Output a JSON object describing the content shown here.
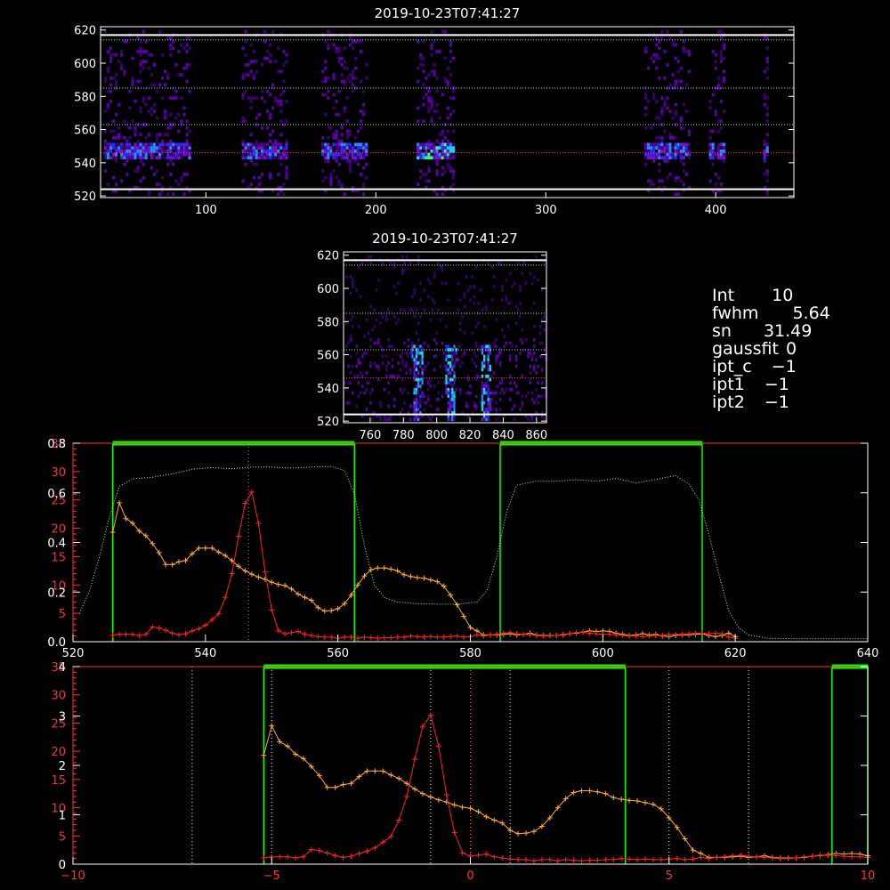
{
  "colors": {
    "background": "#000000",
    "frame": "#ffffff",
    "green": "#00ff00",
    "orange": "#ffaa33",
    "red": "#ff2020",
    "dotted_yellow": "#ffff99",
    "dotted_green": "#b8ff66",
    "axis_red": "#ff3030"
  },
  "info_panel": [
    {
      "label": "Int",
      "value": "10"
    },
    {
      "label": "fwhm",
      "value": "5.64"
    },
    {
      "label": "sn",
      "value": "31.49"
    },
    {
      "label": "gaussfit",
      "value": "0"
    },
    {
      "label": "ipt_c",
      "value": "−1"
    },
    {
      "label": "ipt1",
      "value": "−1"
    },
    {
      "label": "ipt2",
      "value": "−1"
    }
  ],
  "chart_data": [
    {
      "type": "heatmap",
      "title": "2019-10-23T07:41:27",
      "xlim": [
        38,
        446
      ],
      "ylim": [
        519,
        622
      ],
      "xticks": [
        100,
        200,
        300,
        400
      ],
      "yticks": [
        520,
        540,
        560,
        580,
        600,
        620
      ],
      "hlines_solid": [
        617,
        524
      ],
      "hlines_dotted": [
        614,
        585,
        563,
        546
      ],
      "data_columns": [
        [
          40,
          91
        ],
        [
          121,
          147
        ],
        [
          168,
          195
        ],
        [
          224,
          245
        ],
        [
          358,
          385
        ],
        [
          396,
          405
        ],
        [
          428,
          431
        ]
      ],
      "bright_band": [
        541,
        551
      ]
    },
    {
      "type": "heatmap",
      "title": "2019-10-23T07:41:27",
      "xlim": [
        744,
        866
      ],
      "ylim": [
        519,
        622
      ],
      "xticks": [
        760,
        780,
        800,
        820,
        840,
        860
      ],
      "yticks": [
        520,
        540,
        560,
        580,
        600,
        620
      ],
      "hlines_solid": [
        617,
        524
      ],
      "hlines_dotted": [
        614,
        585,
        563,
        546
      ],
      "bright_streaks_x": [
        788,
        808,
        829
      ]
    },
    {
      "type": "line",
      "xlim": [
        520,
        640
      ],
      "xticks": [
        520,
        540,
        560,
        580,
        600,
        620,
        640
      ],
      "ylim_left_red": [
        0,
        35
      ],
      "yticks_left_red": [
        "0.0",
        "5",
        "10",
        "15",
        "20",
        "25",
        "30",
        "35"
      ],
      "ylim_left_white": [
        0,
        4
      ],
      "yticks_left_white": [
        "0.0",
        "0.2",
        "0.4",
        "0.6",
        "0.8"
      ],
      "green_bands": [
        [
          526,
          562.5
        ],
        [
          584.5,
          615
        ]
      ],
      "vline_dotted": 546.5,
      "series": [
        {
          "color": "orange",
          "x": [
            526.0,
            527.0,
            528.0,
            529.0,
            530.0,
            531.0,
            532.0,
            533.0,
            534.0,
            535.0,
            536.0,
            537.0,
            538.0,
            539.0,
            540.0,
            541.0,
            542.0,
            543.0,
            544.0,
            545.0,
            546.0,
            547.0,
            548.0,
            549.0,
            550.0,
            551.0,
            552.0,
            553.0,
            554.0,
            555.0,
            556.0,
            557.0,
            558.0,
            559.0,
            560.0,
            561.0,
            562.0,
            563.0,
            564.0,
            565.0,
            566.0,
            567.0,
            568.0,
            569.0,
            570.0,
            571.0,
            572.0,
            573.0,
            574.0,
            575.0,
            576.0,
            577.0,
            578.0,
            579.0,
            580.0,
            581.0,
            582.0,
            583.0,
            584.0,
            585.0,
            586.0,
            587.0,
            588.0,
            589.0,
            590.0,
            591.0,
            592.0,
            593.0,
            594.0,
            595.0,
            596.0,
            597.0,
            598.0,
            599.0,
            600.0,
            601.0,
            602.0,
            603.0,
            604.0,
            605.0,
            606.0,
            607.0,
            608.0,
            609.0,
            610.0,
            611.0,
            612.0,
            613.0,
            614.0,
            615.0,
            616.0,
            617.0,
            618.0,
            619.0,
            620.0
          ],
          "y": [
            19.3,
            24.5,
            21.7,
            20.9,
            19.5,
            18.7,
            17.3,
            15.7,
            13.6,
            13.6,
            14.1,
            14.3,
            15.5,
            16.5,
            16.5,
            16.5,
            15.8,
            15.2,
            14.3,
            13.3,
            12.5,
            11.9,
            11.4,
            11.0,
            10.5,
            10.1,
            9.9,
            9.3,
            8.4,
            7.8,
            7.3,
            6.0,
            5.4,
            5.5,
            5.8,
            6.7,
            8.2,
            10.0,
            11.6,
            12.7,
            13.0,
            13.0,
            12.8,
            12.5,
            11.8,
            11.5,
            11.3,
            11.2,
            10.9,
            10.6,
            9.8,
            8.2,
            6.5,
            4.5,
            2.5,
            1.9,
            1.2,
            1.2,
            1.2,
            1.3,
            1.4,
            1.2,
            1.3,
            1.5,
            1.2,
            1.1,
            1.1,
            1.1,
            1.2,
            1.4,
            1.5,
            1.7,
            1.9,
            1.8,
            1.9,
            1.8,
            1.5,
            1.3,
            1.1,
            1.2,
            1.4,
            1.2,
            1.3,
            1.0,
            0.9,
            1.1,
            1.2,
            1.2,
            1.3,
            1.4,
            1.1,
            0.9,
            1.1,
            1.5,
            0.9
          ]
        },
        {
          "color": "red",
          "x": [
            526.0,
            527.0,
            528.0,
            529.0,
            530.0,
            531.0,
            532.0,
            533.0,
            534.0,
            535.0,
            536.0,
            537.0,
            538.0,
            539.0,
            540.0,
            541.0,
            542.0,
            543.0,
            544.0,
            545.0,
            546.0,
            547.0,
            548.0,
            549.0,
            550.0,
            551.0,
            552.0,
            553.0,
            554.0,
            555.0,
            556.0,
            557.0,
            558.0,
            559.0,
            560.0,
            561.0,
            562.0,
            563.0,
            564.0,
            565.0,
            566.0,
            567.0,
            568.0,
            569.0,
            570.0,
            571.0,
            572.0,
            573.0,
            574.0,
            575.0,
            576.0,
            577.0,
            578.0,
            579.0,
            580.0,
            581.0,
            582.0,
            583.0,
            584.0,
            585.0,
            586.0,
            587.0,
            588.0,
            589.0,
            590.0,
            591.0,
            592.0,
            593.0,
            594.0,
            595.0,
            596.0,
            597.0,
            598.0,
            599.0,
            600.0,
            601.0,
            602.0,
            603.0,
            604.0,
            605.0,
            606.0,
            607.0,
            608.0,
            609.0,
            610.0,
            611.0,
            612.0,
            613.0,
            614.0,
            615.0,
            616.0,
            617.0,
            618.0,
            619.0,
            620.0
          ],
          "y": [
            1.1,
            1.3,
            1.3,
            1.3,
            1.1,
            1.3,
            2.6,
            2.4,
            2.0,
            1.5,
            1.2,
            1.4,
            1.9,
            2.3,
            2.9,
            3.9,
            4.9,
            7.8,
            12.0,
            18.6,
            24.4,
            26.4,
            20.9,
            12.3,
            5.6,
            2.0,
            1.4,
            1.6,
            1.8,
            1.3,
            1.1,
            0.9,
            0.8,
            0.8,
            0.6,
            0.8,
            0.8,
            0.6,
            0.8,
            0.7,
            0.6,
            0.7,
            0.7,
            0.8,
            0.8,
            1.0,
            0.9,
            0.8,
            0.9,
            0.8,
            0.8,
            0.9,
            1.0,
            0.8,
            0.9,
            1.2,
            1.0,
            1.2,
            1.3,
            1.5,
            1.6,
            1.4,
            1.3,
            1.2,
            1.1,
            1.0,
            1.0,
            1.1,
            1.3,
            1.4,
            1.6,
            1.6,
            1.5,
            1.4,
            1.3,
            1.3,
            1.2,
            1.1,
            1.0,
            1.0,
            0.9,
            1.0,
            1.1,
            1.1,
            1.3,
            1.3,
            1.3,
            1.4,
            1.5,
            1.5,
            1.4,
            1.5,
            1.4,
            0.8,
            0.6
          ]
        },
        {
          "color": "dotted_green",
          "style": "dotted",
          "x": [
            521,
            522.5,
            524,
            525.5,
            527,
            529,
            532,
            535,
            538,
            541,
            544,
            547,
            550,
            553,
            556,
            559,
            561,
            562.5,
            564,
            565.5,
            567,
            569,
            572,
            575,
            578,
            581,
            582.5,
            584,
            585.5,
            587,
            590,
            593,
            596,
            599,
            602,
            605,
            608,
            611,
            613,
            614.5,
            616,
            617.5,
            619,
            620.5,
            622,
            625,
            630,
            635,
            640
          ],
          "y": [
            5,
            9,
            15,
            22,
            27.4,
            28.7,
            29.0,
            29.6,
            30.4,
            30.7,
            30.5,
            30.8,
            30.8,
            30.6,
            30.8,
            30.9,
            30.2,
            26,
            17,
            10,
            7.8,
            7.0,
            6.7,
            6.6,
            6.6,
            7.0,
            9,
            15,
            23,
            27.6,
            28.3,
            28.3,
            28.6,
            28.3,
            28.8,
            28.0,
            28.6,
            29.3,
            27.8,
            25,
            19,
            12,
            5.5,
            2.5,
            1.2,
            0.6,
            0.5,
            0.5,
            0.5
          ]
        }
      ]
    },
    {
      "type": "line",
      "xlim": [
        -10,
        10
      ],
      "xticks": [
        -10,
        -5,
        0,
        5,
        10
      ],
      "ylim_left_red": [
        0,
        35
      ],
      "yticks_left_red": [
        "0",
        "5",
        "10",
        "15",
        "20",
        "25",
        "30",
        "35"
      ],
      "ylim_left_white": [
        0,
        4
      ],
      "yticks_left_white": [
        "0",
        "1",
        "2",
        "3",
        "4"
      ],
      "green_bands": [
        [
          -5.2,
          3.9
        ],
        [
          9.1,
          10
        ]
      ],
      "vlines_dotted": [
        -7.0,
        -5.0,
        -1.0,
        0.0,
        1.0,
        5.0,
        7.0
      ],
      "series": [
        {
          "color": "orange",
          "x": [
            -5.2,
            -5.0,
            -4.8,
            -4.6,
            -4.4,
            -4.2,
            -4.0,
            -3.8,
            -3.6,
            -3.4,
            -3.2,
            -3.0,
            -2.8,
            -2.6,
            -2.4,
            -2.2,
            -2.0,
            -1.8,
            -1.6,
            -1.4,
            -1.2,
            -1.0,
            -0.8,
            -0.6,
            -0.4,
            -0.2,
            0.0,
            0.2,
            0.4,
            0.6,
            0.8,
            1.0,
            1.2,
            1.4,
            1.6,
            1.8,
            2.0,
            2.2,
            2.4,
            2.6,
            2.8,
            3.0,
            3.2,
            3.4,
            3.6,
            3.8,
            4.0,
            4.2,
            4.4,
            4.6,
            4.8,
            5.0,
            5.2,
            5.4,
            5.6,
            5.8,
            6.0,
            6.2,
            6.4,
            6.6,
            6.8,
            7.0,
            7.2,
            7.4,
            7.6,
            7.8,
            8.0,
            8.2,
            8.4,
            8.6,
            8.8,
            9.0,
            9.2,
            9.4,
            9.6,
            9.8,
            10.0
          ],
          "y": [
            19.3,
            24.5,
            21.7,
            20.9,
            19.5,
            18.7,
            17.3,
            15.7,
            13.6,
            13.6,
            14.1,
            14.3,
            15.5,
            16.5,
            16.5,
            16.5,
            15.8,
            15.2,
            14.3,
            13.3,
            12.5,
            11.9,
            11.4,
            11.0,
            10.5,
            10.1,
            9.9,
            9.3,
            8.4,
            7.8,
            7.3,
            6.0,
            5.4,
            5.5,
            5.8,
            6.7,
            8.2,
            10.0,
            11.6,
            12.7,
            13.0,
            13.0,
            12.8,
            12.5,
            11.8,
            11.5,
            11.3,
            11.2,
            10.9,
            10.6,
            9.8,
            8.2,
            6.5,
            4.5,
            2.5,
            1.9,
            1.2,
            1.2,
            1.2,
            1.3,
            1.4,
            1.2,
            1.3,
            1.5,
            1.2,
            1.1,
            1.1,
            1.1,
            1.2,
            1.4,
            1.5,
            1.7,
            1.9,
            1.8,
            1.9,
            1.8,
            1.5
          ]
        },
        {
          "color": "red",
          "x": [
            -5.2,
            -5.0,
            -4.8,
            -4.6,
            -4.4,
            -4.2,
            -4.0,
            -3.8,
            -3.6,
            -3.4,
            -3.2,
            -3.0,
            -2.8,
            -2.6,
            -2.4,
            -2.2,
            -2.0,
            -1.8,
            -1.6,
            -1.4,
            -1.2,
            -1.0,
            -0.8,
            -0.6,
            -0.4,
            -0.2,
            0.0,
            0.2,
            0.4,
            0.6,
            0.8,
            1.0,
            1.2,
            1.4,
            1.6,
            1.8,
            2.0,
            2.2,
            2.4,
            2.6,
            2.8,
            3.0,
            3.2,
            3.4,
            3.6,
            3.8,
            4.0,
            4.2,
            4.4,
            4.6,
            4.8,
            5.0,
            5.2,
            5.4,
            5.6,
            5.8,
            6.0,
            6.2,
            6.4,
            6.6,
            6.8,
            7.0,
            7.2,
            7.4,
            7.6,
            7.8,
            8.0,
            8.2,
            8.4,
            8.6,
            8.8,
            9.0,
            9.2,
            9.4,
            9.6,
            9.8,
            10.0
          ],
          "y": [
            1.1,
            1.3,
            1.3,
            1.3,
            1.1,
            1.3,
            2.6,
            2.4,
            2.0,
            1.5,
            1.2,
            1.4,
            1.9,
            2.3,
            2.9,
            3.9,
            4.9,
            7.8,
            12.0,
            18.6,
            24.4,
            26.4,
            20.9,
            12.3,
            5.6,
            2.0,
            1.4,
            1.6,
            1.8,
            1.3,
            1.1,
            0.9,
            0.8,
            0.8,
            0.6,
            0.8,
            0.8,
            0.6,
            0.8,
            0.7,
            0.6,
            0.7,
            0.7,
            0.8,
            0.8,
            1.0,
            0.9,
            0.8,
            0.9,
            0.8,
            0.8,
            0.9,
            1.0,
            0.8,
            0.9,
            1.2,
            1.0,
            1.2,
            1.3,
            1.5,
            1.6,
            1.4,
            1.3,
            1.2,
            1.1,
            1.0,
            1.0,
            1.1,
            1.3,
            1.4,
            1.6,
            1.6,
            1.5,
            1.4,
            1.3,
            1.3,
            1.2
          ]
        }
      ]
    }
  ]
}
